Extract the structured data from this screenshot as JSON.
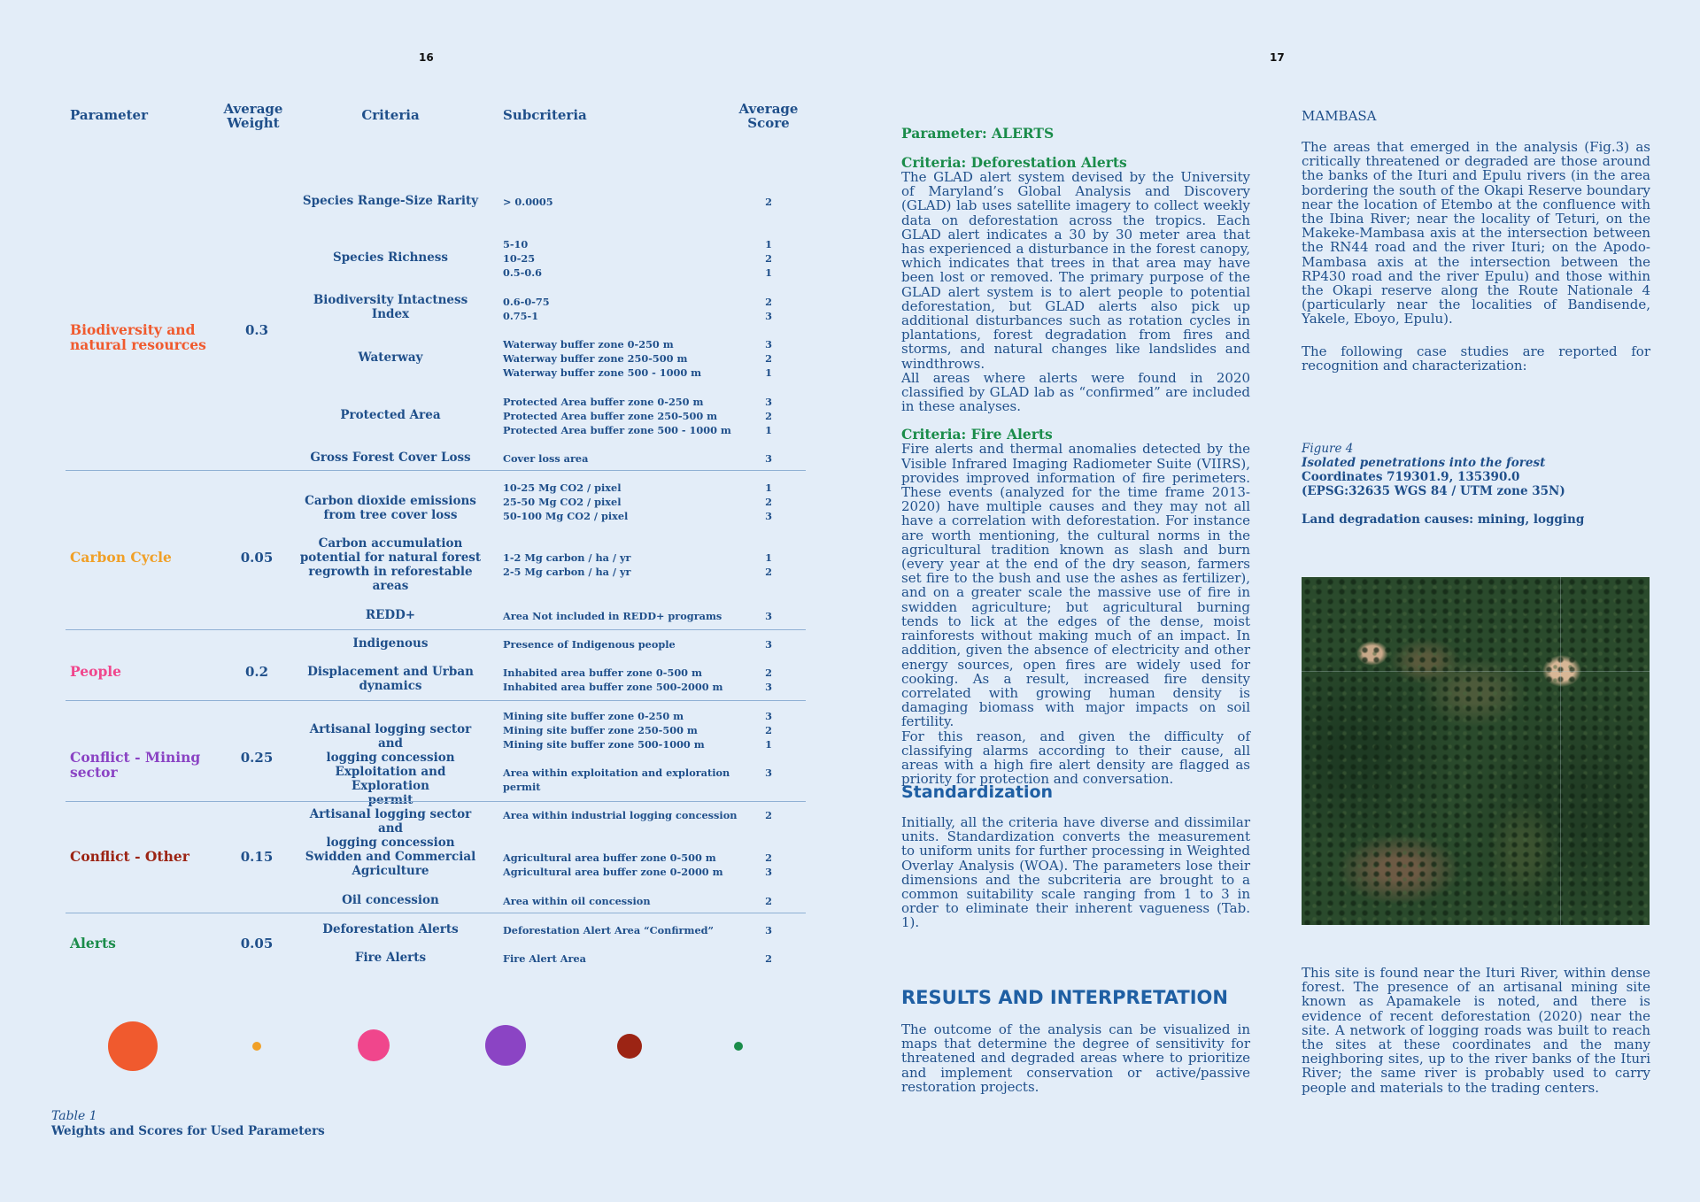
{
  "left_page": {
    "page_number": "16",
    "headers": {
      "parameter": "Parameter",
      "avg_weight_1": "Average",
      "avg_weight_2": "Weight",
      "criteria": "Criteria",
      "subcriteria": "Subcriteria",
      "avg_score_1": "Average",
      "avg_score_2": "Score"
    },
    "groups": [
      {
        "parameter_1": "Biodiversity and",
        "parameter_2": "natural resources",
        "weight": "0.3",
        "color": "#f05a2e",
        "criteria": [
          {
            "name_1": "Species Range-Size Rarity",
            "subs": [
              {
                "text": "> 0.0005",
                "score": "2"
              }
            ]
          },
          {
            "name_1": "Species Richness",
            "subs": [
              {
                "text": "5-10",
                "score": "1"
              },
              {
                "text": "10-25",
                "score": "2"
              },
              {
                "text": "0.5-0.6",
                "score": "1"
              }
            ]
          },
          {
            "name_1": "Biodiversity Intactness Index",
            "subs": [
              {
                "text": "0.6-0-75",
                "score": "2"
              },
              {
                "text": "0.75-1",
                "score": "3"
              }
            ]
          },
          {
            "name_1": "Waterway",
            "subs": [
              {
                "text": "Waterway buffer zone 0-250 m",
                "score": "3"
              },
              {
                "text": "Waterway buffer zone 250-500 m",
                "score": "2"
              },
              {
                "text": "Waterway buffer zone 500 - 1000 m",
                "score": "1"
              }
            ]
          },
          {
            "name_1": "Protected Area",
            "subs": [
              {
                "text": "Protected Area buffer zone 0-250 m",
                "score": "3"
              },
              {
                "text": "Protected Area buffer zone 250-500 m",
                "score": "2"
              },
              {
                "text": "Protected Area buffer zone 500 - 1000 m",
                "score": "1"
              }
            ]
          },
          {
            "name_1": "Gross Forest Cover Loss",
            "subs": [
              {
                "text": "Cover loss area",
                "score": "3"
              }
            ]
          }
        ]
      },
      {
        "parameter_1": "Carbon Cycle",
        "weight": "0.05",
        "color": "#f0a028",
        "criteria": [
          {
            "name_1": "Carbon dioxide emissions",
            "name_2": "from tree cover loss",
            "subs": [
              {
                "text": "10-25 Mg CO2 / pixel",
                "score": "1"
              },
              {
                "text": "25-50 Mg CO2 / pixel",
                "score": "2"
              },
              {
                "text": "50-100 Mg CO2 / pixel",
                "score": "3"
              }
            ]
          },
          {
            "name_1": "Carbon accumulation",
            "name_2": "potential for natural forest",
            "name_3": "regrowth in reforestable",
            "name_4": "areas",
            "subs": [
              {
                "text": "1-2 Mg carbon / ha / yr",
                "score": "1"
              },
              {
                "text": "2-5 Mg carbon / ha / yr",
                "score": "2"
              }
            ]
          },
          {
            "name_1": "REDD+",
            "subs": [
              {
                "text": "Area Not included in REDD+ programs",
                "score": "3"
              }
            ]
          }
        ]
      },
      {
        "parameter_1": "People",
        "weight": "0.2",
        "color": "#f0468c",
        "criteria": [
          {
            "name_1": "Indigenous",
            "subs": [
              {
                "text": "Presence of Indigenous people",
                "score": "3"
              }
            ]
          },
          {
            "name_1": "Displacement and Urban",
            "name_2": "dynamics",
            "subs": [
              {
                "text": "Inhabited area buffer zone 0-500 m",
                "score": "2"
              },
              {
                "text": "Inhabited area buffer zone 500-2000 m",
                "score": "3"
              }
            ]
          }
        ]
      },
      {
        "parameter_1": "Conflict - Mining",
        "parameter_2": "sector",
        "weight": "0.25",
        "color": "#8b44c4",
        "criteria": [
          {
            "name_1": "Artisanal logging sector and",
            "name_2": "logging concession",
            "subs": [
              {
                "text": "Mining site buffer zone 0-250 m",
                "score": "3"
              },
              {
                "text": "Mining site buffer zone 250-500 m",
                "score": "2"
              },
              {
                "text": "Mining site buffer zone 500-1000 m",
                "score": "1"
              }
            ]
          },
          {
            "name_1": "Exploitation and Exploration",
            "name_2": "permit",
            "subs": [
              {
                "text": "Area within exploitation and exploration",
                "text_2": "permit",
                "score": "3"
              }
            ]
          }
        ]
      },
      {
        "parameter_1": "Conflict - Other",
        "weight": "0.15",
        "color": "#9c2414",
        "criteria": [
          {
            "name_1": "Artisanal logging sector and",
            "name_2": "logging concession",
            "subs": [
              {
                "text": "Area within industrial logging concession",
                "score": "2"
              }
            ]
          },
          {
            "name_1": "Swidden and Commercial",
            "name_2": "Agriculture",
            "subs": [
              {
                "text": "Agricultural area buffer zone 0-500 m",
                "score": "2"
              },
              {
                "text": "Agricultural area buffer zone 0-2000 m",
                "score": "3"
              }
            ]
          },
          {
            "name_1": "Oil concession",
            "subs": [
              {
                "text": "Area within oil concession",
                "score": "2"
              }
            ]
          }
        ]
      },
      {
        "parameter_1": "Alerts",
        "weight": "0.05",
        "color": "#1a8c4a",
        "criteria": [
          {
            "name_1": "Deforestation Alerts",
            "subs": [
              {
                "text": "Deforestation Alert Area “Confirmed”",
                "score": "3"
              }
            ]
          },
          {
            "name_1": "Fire Alerts",
            "subs": [
              {
                "text": "Fire Alert Area",
                "score": "2"
              }
            ]
          }
        ]
      }
    ],
    "circle_colors": [
      "#f05a2e",
      "#f0a028",
      "#f0468c",
      "#8b44c4",
      "#9c2414",
      "#1a8c4a"
    ],
    "caption_label": "Table 1",
    "caption_text": "Weights and Scores for Used Parameters"
  },
  "right_page": {
    "page_number": "17",
    "param_heading": "Parameter: ALERTS",
    "crit_deforestation": "Criteria: Deforestation Alerts",
    "deforestation_p1": "The GLAD alert system devised by the University of Maryland’s Global Analysis and Discovery (GLAD) lab uses satellite imagery to collect weekly data on deforestation across the tropics. Each GLAD alert indicates a 30 by 30 meter area that has experienced a disturbance in the forest canopy, which indicates that trees in that area may have been lost or removed. The primary purpose of the GLAD alert system is to alert people to potential deforestation, but GLAD alerts also pick up additional disturbances such as rotation cycles in plantations, forest degradation from fires and storms, and natural changes like landslides and windthrows.",
    "deforestation_p2": "All areas where alerts were found in 2020 classified by GLAD lab  as “confirmed” are included in these analyses.",
    "crit_fire": "Criteria: Fire Alerts",
    "fire_p1": "Fire alerts and thermal anomalies detected by the Visible Infrared Imaging Radiometer Suite (VIIRS), provides improved information of fire perimeters. These events (analyzed for the time frame 2013-2020) have multiple causes and they may not all have a correlation with deforestation. For instance are worth mentioning, the cultural norms in the agricultural tradition known as slash and burn (every year at the end of the dry season, farmers set fire to the bush and use the ashes as fertilizer), and on a greater scale the massive use of fire in swidden agriculture; but agricultural burning tends to lick at the edges  of the dense, moist rainforests without making much of an impact. In addition, given the absence of electricity and other energy sources, open fires are widely used for cooking. As a result, increased fire density correlated with growing human density is damaging biomass with major impacts on soil fertility.",
    "fire_p2": "For this reason, and given the difficulty of classifying alarms according to their cause, all areas with a high fire alert density are flagged as priority for protection and conversation.",
    "standardization_heading": "Standardization",
    "standardization_p": "Initially, all the criteria have diverse and dissimilar units. Standardization converts the measurement to uniform units for further processing in Weighted Overlay Analysis (WOA). The parameters lose their dimensions and the subcriteria are brought to a common suitability scale ranging from 1 to 3 in order to eliminate their inherent vagueness (Tab. 1).",
    "results_heading": "RESULTS AND INTERPRETATION",
    "results_p": "The outcome of the analysis can be visualized in maps that determine the degree of sensitivity for threatened and degraded areas where to prioritize and implement conservation or active/passive restoration projects.",
    "mambasa_heading": "MAMBASA",
    "mambasa_p1": "The areas that emerged in the analysis (Fig.3) as critically threatened or degraded are those around the banks of the Ituri and Epulu rivers (in the area bordering the south of the Okapi Reserve boundary near the location of Etembo at the confluence with the Ibina River; near the locality of Teturi, on the Makeke-Mambasa axis at the intersection between the RN44 road and the river Ituri; on the Apodo-Mambasa axis at the intersection between the RP430 road and the river Epulu) and those within the Okapi reserve along the Route Nationale 4 (particularly near the localities of Bandisende, Yakele, Eboyo, Epulu).",
    "mambasa_p2": "The following case studies are reported for recognition and characterization:",
    "fig_label": "Figure 4",
    "fig_title": "Isolated penetrations into the forest",
    "fig_coords": "Coordinates  719301.9, 135390.0",
    "fig_epsg": "(EPSG:32635 WGS 84 / UTM zone 35N)",
    "fig_causes": "Land degradation causes: mining, logging",
    "site_p": "This site is found near the Ituri River, within dense forest. The presence of an artisanal mining site known as Apamakele is noted, and there is evidence of recent deforestation (2020) near the site. A network of logging roads was built to reach the sites at these coordinates and the many neighboring sites, up to the river banks of the Ituri River; the same river is probably used to carry people and materials to the trading centers."
  }
}
